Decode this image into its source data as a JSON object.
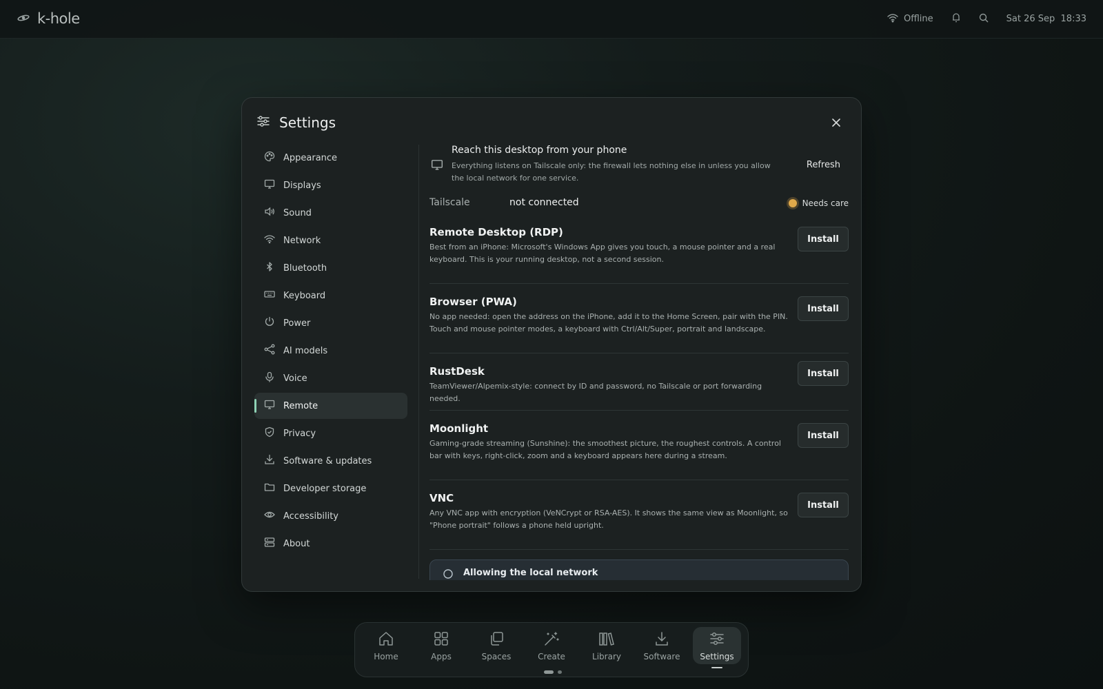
{
  "topbar": {
    "brand": "k-hole",
    "network_status": "Offline",
    "datetime": "Sat 26 Sep  18:33"
  },
  "modal": {
    "title": "Settings",
    "close_icon": "close-icon"
  },
  "sidebar": {
    "active": "Remote",
    "items": [
      {
        "label": "Appearance",
        "icon": "palette-icon"
      },
      {
        "label": "Displays",
        "icon": "monitor-icon"
      },
      {
        "label": "Sound",
        "icon": "speaker-icon"
      },
      {
        "label": "Network",
        "icon": "wifi-icon"
      },
      {
        "label": "Bluetooth",
        "icon": "bluetooth-icon"
      },
      {
        "label": "Keyboard",
        "icon": "keyboard-icon"
      },
      {
        "label": "Power",
        "icon": "power-icon"
      },
      {
        "label": "AI models",
        "icon": "share-nodes-icon"
      },
      {
        "label": "Voice",
        "icon": "microphone-icon"
      },
      {
        "label": "Remote",
        "icon": "monitor-icon"
      },
      {
        "label": "Privacy",
        "icon": "shield-check-icon"
      },
      {
        "label": "Software & updates",
        "icon": "download-icon"
      },
      {
        "label": "Developer storage",
        "icon": "folder-icon"
      },
      {
        "label": "Accessibility",
        "icon": "eye-icon"
      },
      {
        "label": "About",
        "icon": "server-icon"
      }
    ]
  },
  "remote": {
    "intro": {
      "title": "Reach this desktop from your phone",
      "description": "Everything listens on Tailscale only: the firewall lets nothing else in unless you allow the local network for one service.",
      "refresh_label": "Refresh"
    },
    "tailscale": {
      "label": "Tailscale",
      "value": "not connected",
      "status": "Needs care",
      "status_color": "#e0a94a"
    },
    "services": [
      {
        "name": "Remote Desktop (RDP)",
        "description": "Best from an iPhone: Microsoft's Windows App gives you touch, a mouse pointer and a real keyboard. This is your running desktop, not a second session.",
        "action": "Install"
      },
      {
        "name": "Browser (PWA)",
        "description": "No app needed: open the address on the iPhone, add it to the Home Screen, pair with the PIN. Touch and mouse pointer modes, a keyboard with Ctrl/Alt/Super, portrait and landscape.",
        "action": "Install"
      },
      {
        "name": "RustDesk",
        "description": "TeamViewer/Alpemix-style: connect by ID and password, no Tailscale or port forwarding needed.",
        "action": "Install"
      },
      {
        "name": "Moonlight",
        "description": "Gaming-grade streaming (Sunshine): the smoothest picture, the roughest controls. A control bar with keys, right-click, zoom and a keyboard appears here during a stream.",
        "action": "Install"
      },
      {
        "name": "VNC",
        "description": "Any VNC app with encryption (VeNCrypt or RSA-AES). It shows the same view as Moonlight, so \"Phone portrait\" follows a phone held upright.",
        "action": "Install"
      }
    ],
    "callout_title": "Allowing the local network"
  },
  "dock": {
    "active": "Settings",
    "items": [
      {
        "label": "Home",
        "icon": "home-icon"
      },
      {
        "label": "Apps",
        "icon": "grid-icon"
      },
      {
        "label": "Spaces",
        "icon": "copy-icon"
      },
      {
        "label": "Create",
        "icon": "magic-wand-icon"
      },
      {
        "label": "Library",
        "icon": "books-icon"
      },
      {
        "label": "Software",
        "icon": "download-icon"
      },
      {
        "label": "Settings",
        "icon": "sliders-icon"
      }
    ]
  },
  "colors": {
    "accent": "#8fd3b6",
    "background": "#0f1514",
    "panel": "#1c2121"
  }
}
